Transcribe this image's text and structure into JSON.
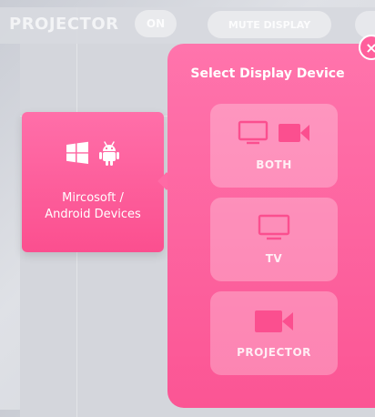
{
  "background_app": {
    "projector_label": "PROJECTOR",
    "power_toggle": "ON",
    "mute_button": "MUTE DISPLAY"
  },
  "device_card": {
    "label_line1": "Mircosoft /",
    "label_line2": "Android Devices",
    "icons": [
      "windows-icon",
      "android-icon"
    ]
  },
  "modal": {
    "title": "Select Display Device",
    "close_symbol": "×",
    "options": [
      {
        "label": "BOTH",
        "icons": [
          "tv-icon",
          "projector-icon"
        ]
      },
      {
        "label": "TV",
        "icons": [
          "tv-icon"
        ]
      },
      {
        "label": "PROJECTOR",
        "icons": [
          "projector-icon"
        ]
      }
    ]
  },
  "colors": {
    "accent_pink": "#fb5594",
    "card_pink": "#ff6fa9"
  }
}
